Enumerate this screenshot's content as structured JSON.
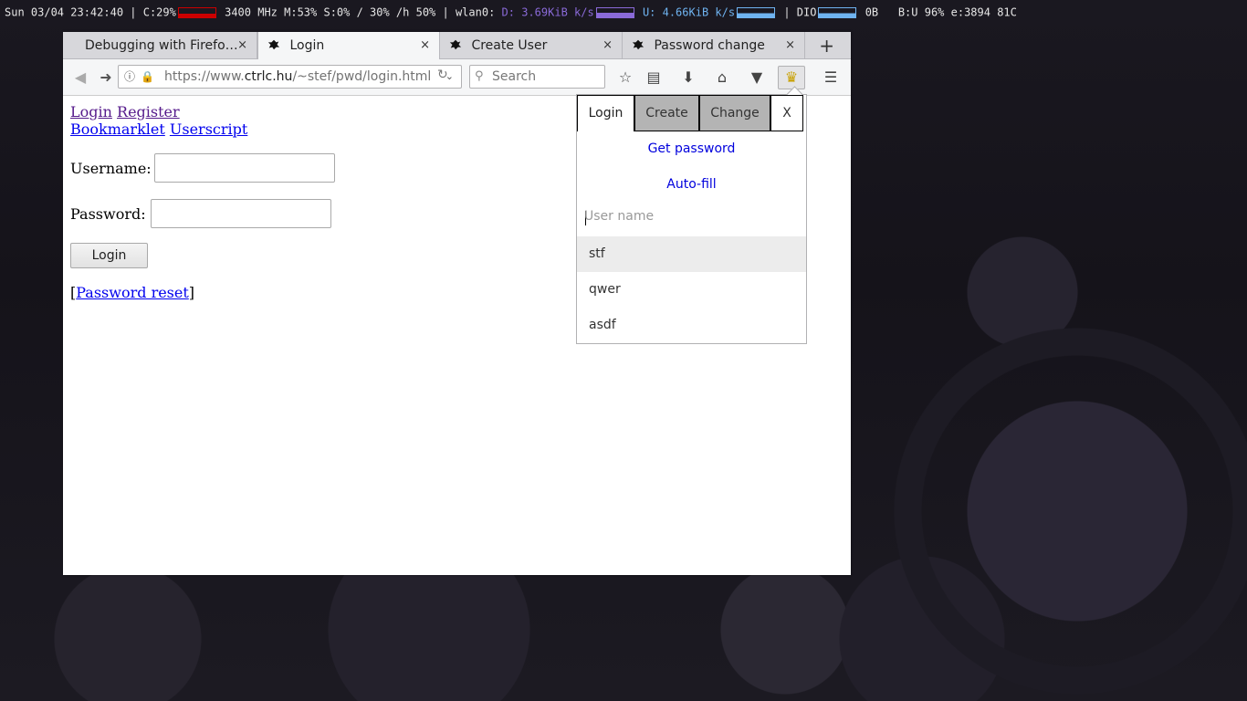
{
  "statusbar": {
    "datetime": "Sun 03/04 23:42:40",
    "cpu": "| C:29%",
    "freq_mem": "3400 MHz M:53% S:0% / 30% /h 50% | wlan0:",
    "down": "D: 3.69KiB k/s",
    "up": "U: 4.66KiB k/s",
    "dio": "| DIO",
    "dio_val": "0B",
    "battery": "B:U 96% e:3894 81C"
  },
  "tabs": [
    {
      "title": "Debugging with Firefo…",
      "close": "×"
    },
    {
      "title": "Login",
      "close": "×"
    },
    {
      "title": "Create User",
      "close": "×"
    },
    {
      "title": "Password change",
      "close": "×"
    }
  ],
  "newtab": "+",
  "navbar": {
    "url_prefix": "https://www.",
    "url_host": "ctrlc.hu",
    "url_path": "/~stef/pwd/login.html",
    "search_placeholder": "Search"
  },
  "page": {
    "links": {
      "login": "Login",
      "register": "Register",
      "bookmarklet": "Bookmarklet",
      "userscript": "Userscript"
    },
    "username_label": "Username:",
    "password_label": "Password:",
    "login_button": "Login",
    "reset_open": "[",
    "reset_link": "Password reset",
    "reset_close": "]"
  },
  "popup": {
    "tabs": [
      "Login",
      "Create",
      "Change",
      "X"
    ],
    "get_password": "Get password",
    "autofill": "Auto-fill",
    "username_placeholder": "User name",
    "users": [
      "stf",
      "qwer",
      "asdf"
    ]
  }
}
